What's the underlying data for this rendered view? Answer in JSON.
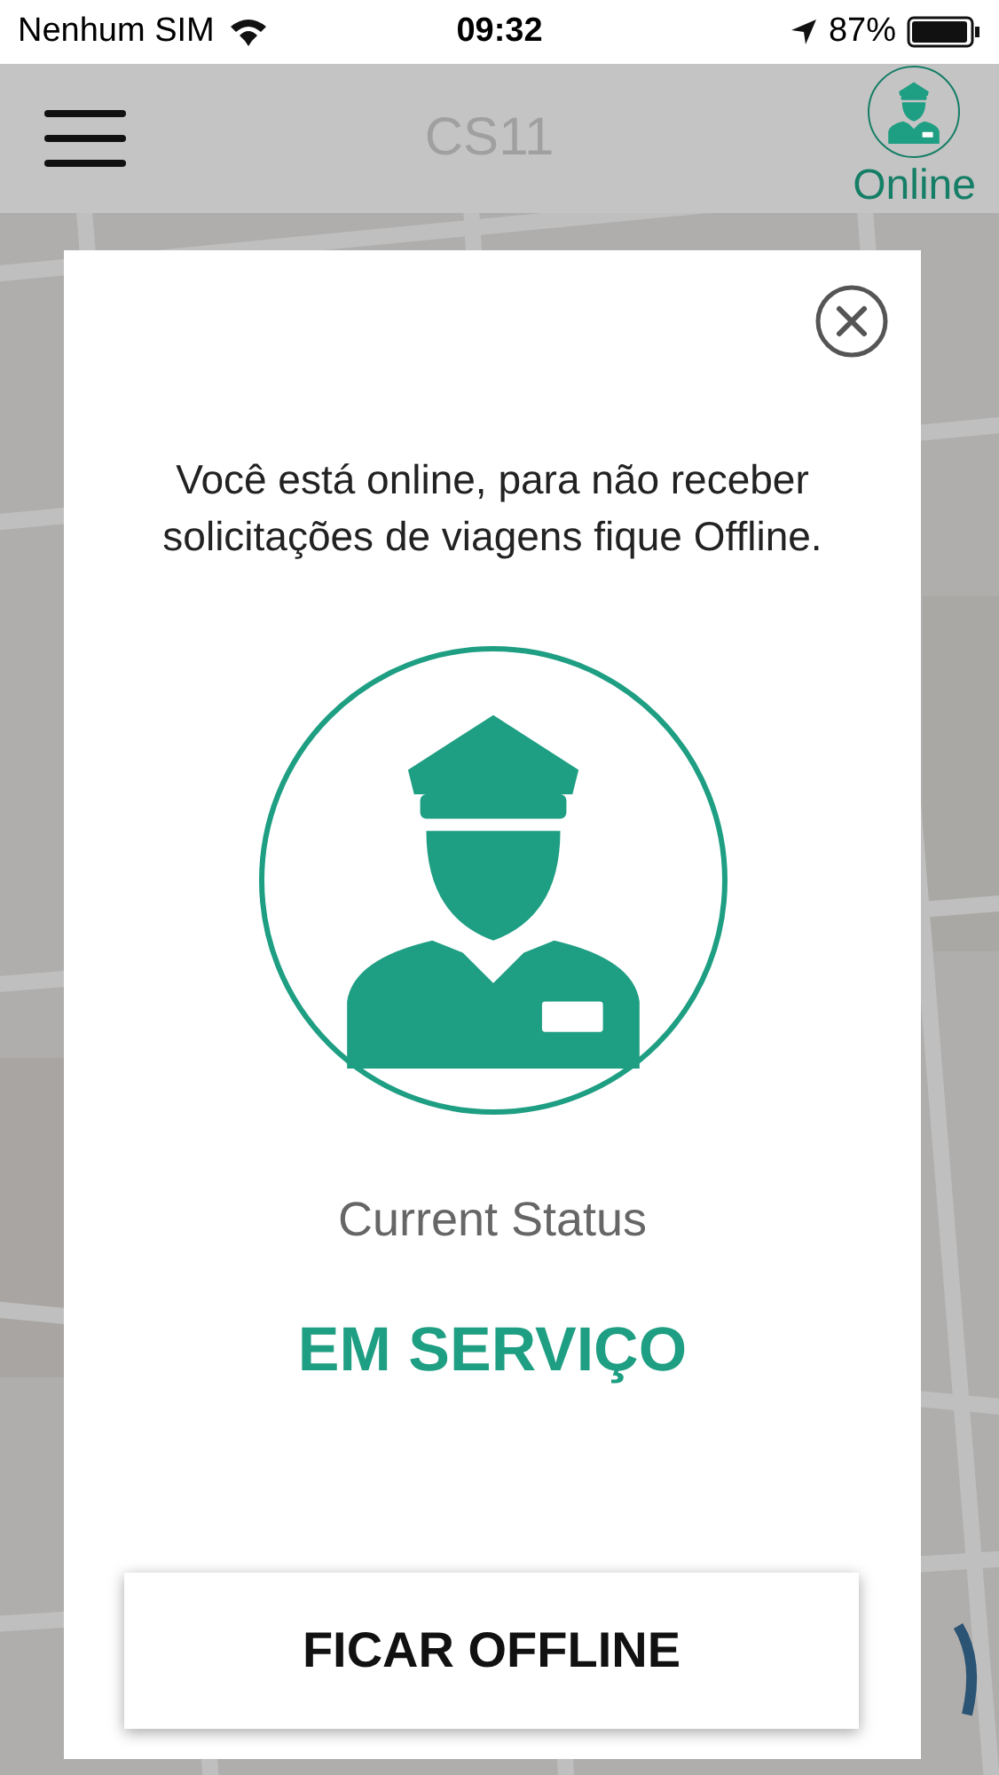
{
  "status_bar": {
    "carrier": "Nenhum SIM",
    "time": "09:32",
    "battery": "87%"
  },
  "nav_bar": {
    "title": "CS11",
    "status_label": "Online"
  },
  "dialog": {
    "message": "Você está online, para não receber solicitações de viagens fique Offline.",
    "status_caption": "Current Status",
    "status_value": "EM SERVIÇO",
    "button": "FICAR OFFLINE"
  }
}
